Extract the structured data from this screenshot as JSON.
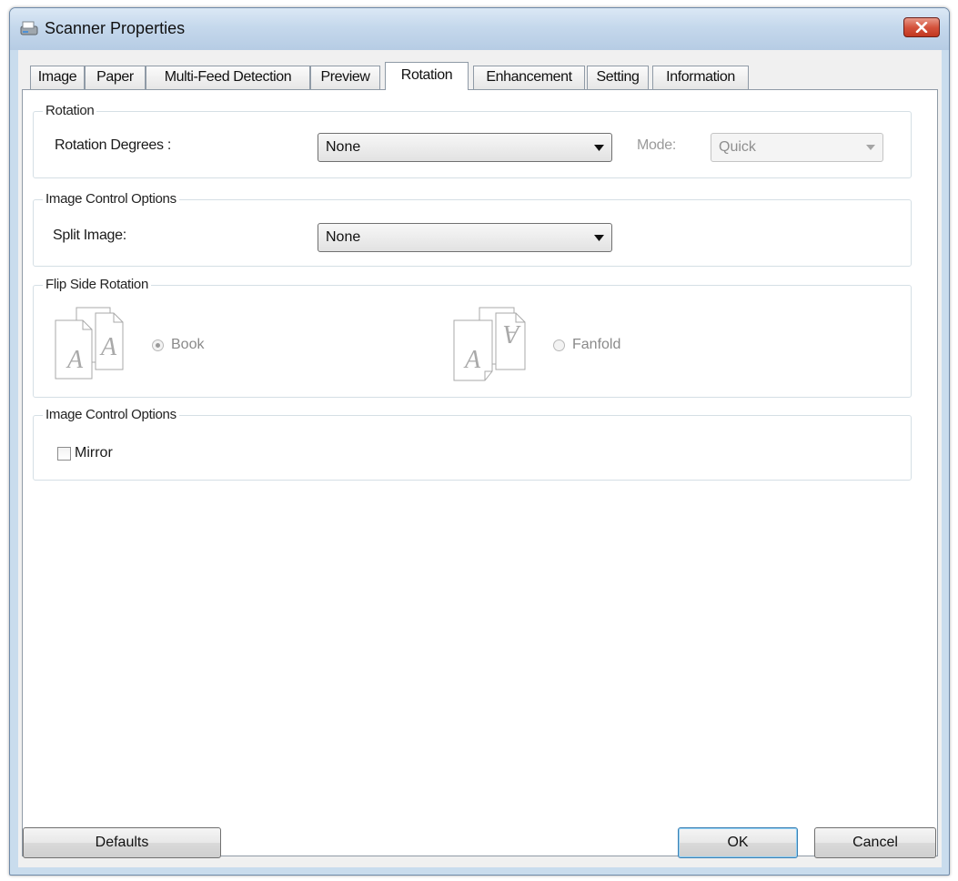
{
  "window": {
    "title": "Scanner Properties"
  },
  "tabs": [
    "Image",
    "Paper",
    "Multi-Feed Detection",
    "Preview",
    "Rotation",
    "Enhancement",
    "Setting",
    "Information"
  ],
  "active_tab": "Rotation",
  "rotation_group": {
    "title": "Rotation",
    "degrees_label": "Rotation Degrees :",
    "degrees_value": "None",
    "mode_label": "Mode:",
    "mode_value": "Quick"
  },
  "image_control_group": {
    "title": "Image Control Options",
    "split_label": "Split Image:",
    "split_value": "None"
  },
  "flip_side_group": {
    "title": "Flip Side Rotation",
    "book_label": "Book",
    "book_selected": true,
    "fanfold_label": "Fanfold",
    "fanfold_selected": false,
    "illustration_glyph": "A"
  },
  "mirror_group": {
    "title": "Image Control Options",
    "mirror_label": "Mirror",
    "mirror_checked": false
  },
  "buttons": {
    "defaults": "Defaults",
    "ok": "OK",
    "cancel": "Cancel"
  },
  "icons": {
    "app": "scanner-icon",
    "close": "close-icon",
    "dropdown": "chevron-down-icon",
    "book": "book-pages-icon",
    "fanfold": "fanfold-pages-icon"
  },
  "colors": {
    "title_bar": "#c5d8ec",
    "close_button": "#d4533d",
    "disabled_text": "#9a9a9a",
    "default_button_border": "#3c7fb1"
  }
}
